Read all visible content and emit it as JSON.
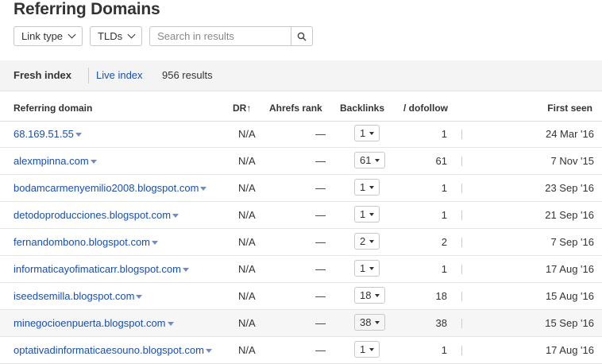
{
  "title": "Referring Domains",
  "filters": {
    "link_type": "Link type",
    "tlds": "TLDs",
    "search_placeholder": "Search in results"
  },
  "tabs": {
    "fresh": "Fresh index",
    "live": "Live index",
    "results": "956 results"
  },
  "columns": {
    "domain": "Referring domain",
    "dr": "DR",
    "ahrefs_rank": "Ahrefs rank",
    "backlinks": "Backlinks",
    "dofollow": "/ dofollow",
    "first_seen": "First seen"
  },
  "rows": [
    {
      "domain": "68.169.51.55",
      "dr": "N/A",
      "rank": "—",
      "backlinks": "1",
      "dofollow": "1",
      "first_seen": "24 Mar '16"
    },
    {
      "domain": "alexmpinna.com",
      "dr": "N/A",
      "rank": "—",
      "backlinks": "61",
      "dofollow": "61",
      "first_seen": "7 Nov '15"
    },
    {
      "domain": "bodamcarmenyemilio2008.blogspot.com",
      "dr": "N/A",
      "rank": "—",
      "backlinks": "1",
      "dofollow": "1",
      "first_seen": "23 Sep '16"
    },
    {
      "domain": "detodoproducciones.blogspot.com",
      "dr": "N/A",
      "rank": "—",
      "backlinks": "1",
      "dofollow": "1",
      "first_seen": "21 Sep '16"
    },
    {
      "domain": "fernandombono.blogspot.com",
      "dr": "N/A",
      "rank": "—",
      "backlinks": "2",
      "dofollow": "2",
      "first_seen": "7 Sep '16"
    },
    {
      "domain": "informaticayofimaticarr.blogspot.com",
      "dr": "N/A",
      "rank": "—",
      "backlinks": "1",
      "dofollow": "1",
      "first_seen": "17 Aug '16"
    },
    {
      "domain": "iseedsemilla.blogspot.com",
      "dr": "N/A",
      "rank": "—",
      "backlinks": "18",
      "dofollow": "18",
      "first_seen": "15 Aug '16"
    },
    {
      "domain": "minegocioenpuerta.blogspot.com",
      "dr": "N/A",
      "rank": "—",
      "backlinks": "38",
      "dofollow": "38",
      "first_seen": "15 Sep '16"
    },
    {
      "domain": "optativadinformaticaesouno.blogspot.com",
      "dr": "N/A",
      "rank": "—",
      "backlinks": "1",
      "dofollow": "1",
      "first_seen": "17 Aug '16"
    }
  ]
}
